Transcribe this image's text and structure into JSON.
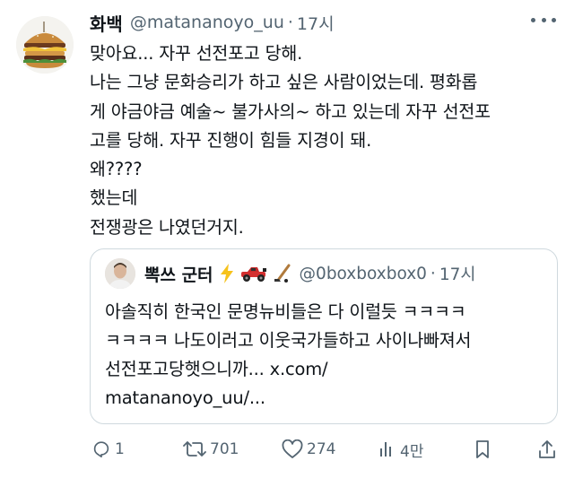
{
  "tweet": {
    "author_name": "화백",
    "handle": "@matananoyo_uu",
    "separator": "·",
    "time": "17시",
    "lines": [
      "맞아요... 자꾸 선전포고 당해.",
      "나는 그냥 문화승리가 하고 싶은 사람이었는데. 평화롭",
      "게 야금야금 예술~ 불가사의~ 하고 있는데 자꾸 선전포",
      "고를 당해. 자꾸 진행이 힘들 지경이 돼.",
      "왜????",
      "했는데",
      "전쟁광은 나였던거지."
    ]
  },
  "quote": {
    "author_name": "뽁쓰 군터",
    "handle": "@0boxboxbox0",
    "separator": "·",
    "time": "17시",
    "lines": [
      "아솔직히 한국인 문명뉴비들은 다 이럴듯 ㅋㅋㅋㅋ",
      "ㅋㅋㅋㅋ 나도이러고 이웃국가들하고 사이나빠져서",
      "선전포고당햇으니까... x.com/",
      "matananoyo_uu/..."
    ]
  },
  "actions": {
    "replies": "1",
    "reposts": "701",
    "likes": "274",
    "views": "4만"
  },
  "icons": [
    "reply-icon",
    "repost-icon",
    "like-icon",
    "views-icon",
    "bookmark-icon",
    "share-icon",
    "more-icon"
  ],
  "colors": {
    "text": "#0f1419",
    "secondary": "#536471",
    "border": "#cfd9de"
  }
}
